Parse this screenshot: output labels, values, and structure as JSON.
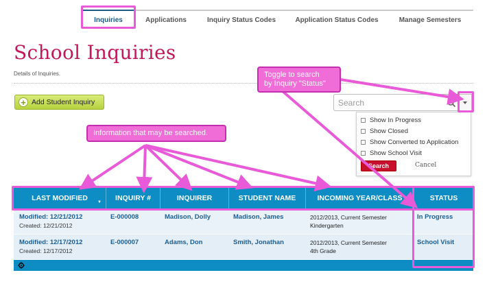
{
  "nav": {
    "tabs": [
      "Inquiries",
      "Applications",
      "Inquiry Status Codes",
      "Application Status Codes",
      "Manage Semesters"
    ],
    "active_index": 0
  },
  "page": {
    "title": "School Inquiries",
    "subtitle": "Details of Inquiries."
  },
  "toolbar": {
    "add_button_label": "Add Student Inquiry",
    "search_placeholder": "Search"
  },
  "filter_menu": {
    "options": [
      "Show In Progress",
      "Show Closed",
      "Show Converted to Application",
      "Show School Visit"
    ],
    "search_button": "Search",
    "cancel_link": "Cancel"
  },
  "table": {
    "columns": [
      "LAST MODIFIED",
      "INQUIRY #",
      "INQUIRER",
      "STUDENT NAME",
      "INCOMING YEAR/CLASS",
      "STATUS"
    ],
    "rows": [
      {
        "modified": "Modified: 12/21/2012",
        "created": "Created: 12/21/2012",
        "inquiry_no": "E-000008",
        "inquirer": "Madison, Dolly",
        "student": "Madison,  James",
        "year": "2012/2013, Current Semester",
        "class": "Kindergarten",
        "status": "In Progress"
      },
      {
        "modified": "Modified: 12/17/2012",
        "created": "Created: 12/17/2012",
        "inquiry_no": "E-000007",
        "inquirer": "Adams, Don",
        "student": "Smith, Jonathan",
        "year": "2012/2013, Current Semester",
        "class": "4th Grade",
        "status": "School Visit"
      }
    ]
  },
  "annotations": {
    "toggle_note_line1": "Toggle to search",
    "toggle_note_line2": "by Inquiry \"Status\"",
    "search_note": "Information that may be searched."
  },
  "colors": {
    "title": "#c2185b",
    "table_header": "#0e8cc4",
    "link": "#1b5d93",
    "annotation": "#f06cd6",
    "search_button": "#c8102e"
  }
}
